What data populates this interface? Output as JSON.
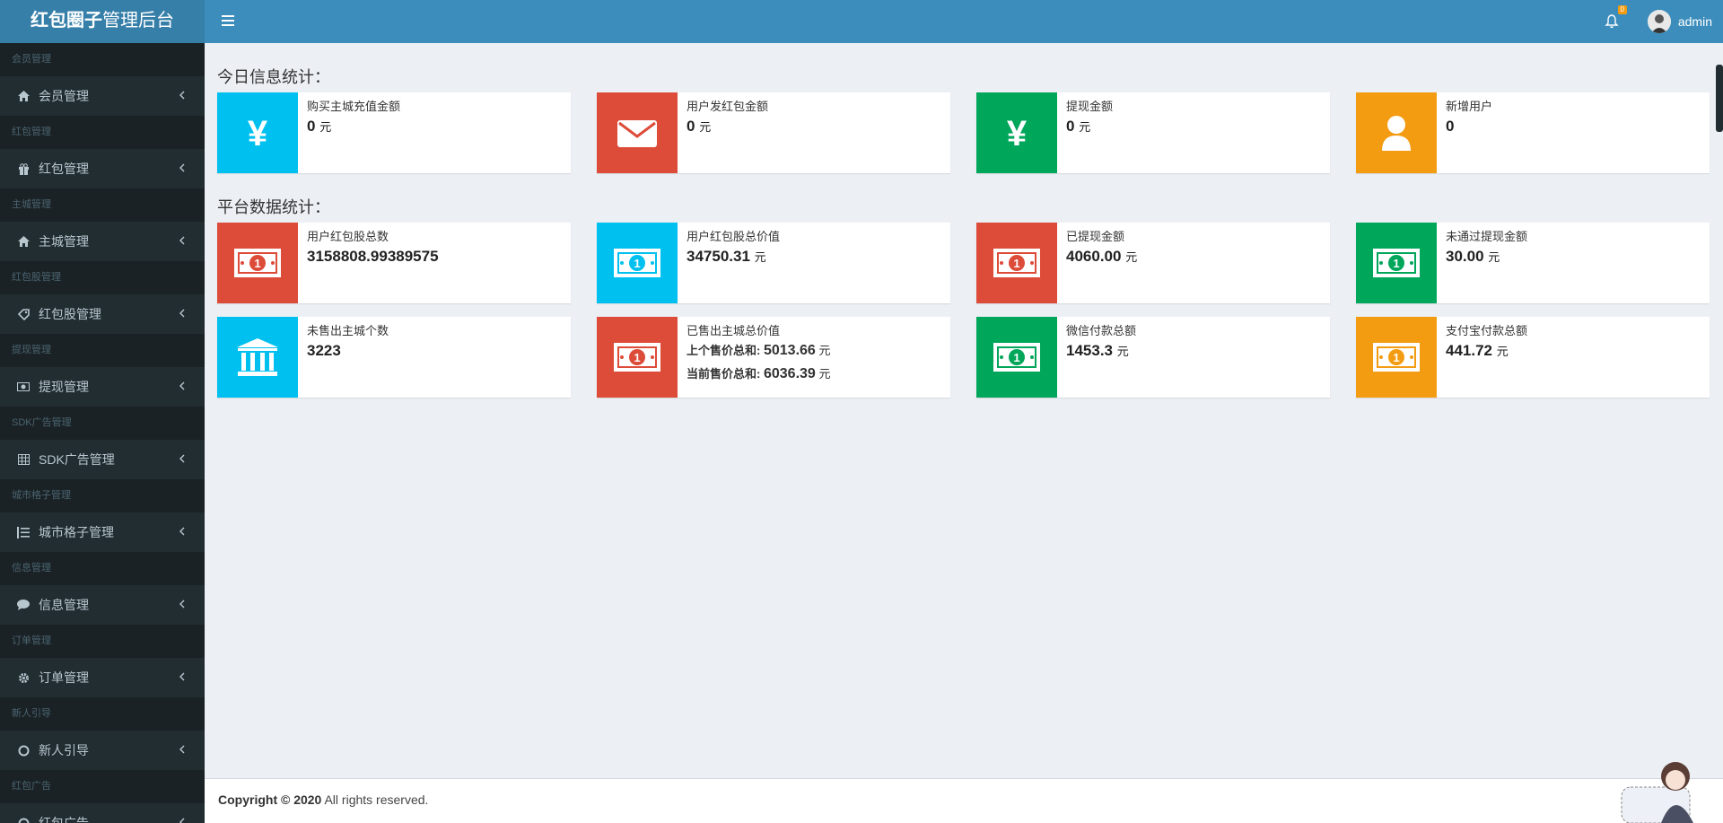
{
  "header": {
    "logo_bold": "红包圈子",
    "logo_rest": "管理后台",
    "notification_count": "0",
    "username": "admin"
  },
  "sidebar": [
    {
      "header": "会员管理",
      "label": "会员管理",
      "icon": "home-icon"
    },
    {
      "header": "红包管理",
      "label": "红包管理",
      "icon": "gift-icon"
    },
    {
      "header": "主城管理",
      "label": "主城管理",
      "icon": "home-icon"
    },
    {
      "header": "红包股管理",
      "label": "红包股管理",
      "icon": "tag-icon"
    },
    {
      "header": "提现管理",
      "label": "提现管理",
      "icon": "money-icon"
    },
    {
      "header": "SDK广告管理",
      "label": "SDK广告管理",
      "icon": "table-icon"
    },
    {
      "header": "城市格子管理",
      "label": "城市格子管理",
      "icon": "list-icon"
    },
    {
      "header": "信息管理",
      "label": "信息管理",
      "icon": "comment-icon"
    },
    {
      "header": "订单管理",
      "label": "订单管理",
      "icon": "gear-icon"
    },
    {
      "header": "新人引导",
      "label": "新人引导",
      "icon": "circle-icon"
    },
    {
      "header": "红包广告",
      "label": "红包广告",
      "icon": "circle-icon"
    }
  ],
  "today": {
    "title": "今日信息统计：",
    "boxes": [
      {
        "label": "购买主城充值金额",
        "value": "0",
        "unit": "元",
        "color": "#00c0ef",
        "icon": "yen-icon"
      },
      {
        "label": "用户发红包金额",
        "value": "0",
        "unit": "元",
        "color": "#dd4b39",
        "icon": "envelope-icon"
      },
      {
        "label": "提现金额",
        "value": "0",
        "unit": "元",
        "color": "#00a65a",
        "icon": "yen-icon"
      },
      {
        "label": "新增用户",
        "value": "0",
        "unit": "",
        "color": "#f39c12",
        "icon": "user-icon"
      }
    ]
  },
  "platform": {
    "title": "平台数据统计：",
    "boxes": [
      {
        "label": "用户红包股总数",
        "value": "3158808.99389575",
        "unit": "",
        "color": "#dd4b39",
        "icon": "money-icon"
      },
      {
        "label": "用户红包股总价值",
        "value": "34750.31",
        "unit": "元",
        "color": "#00c0ef",
        "icon": "money-icon"
      },
      {
        "label": "已提现金额",
        "value": "4060.00",
        "unit": "元",
        "color": "#dd4b39",
        "icon": "money-icon"
      },
      {
        "label": "未通过提现金额",
        "value": "30.00",
        "unit": "元",
        "color": "#00a65a",
        "icon": "money-icon"
      },
      {
        "label": "未售出主城个数",
        "value": "3223",
        "unit": "",
        "color": "#00c0ef",
        "icon": "bank-icon"
      },
      {
        "label": "已售出主城总价值",
        "sub1_label": "上个售价总和:",
        "sub1_value": "5013.66",
        "sub2_label": "当前售价总和:",
        "sub2_value": "6036.39",
        "unit": "元",
        "color": "#dd4b39",
        "icon": "money-icon"
      },
      {
        "label": "微信付款总额",
        "value": "1453.3",
        "unit": "元",
        "color": "#00a65a",
        "icon": "money-icon"
      },
      {
        "label": "支付宝付款总额",
        "value": "441.72",
        "unit": "元",
        "color": "#f39c12",
        "icon": "money-icon"
      }
    ]
  },
  "footer": {
    "copyright": "Copyright © 2020",
    "rest": "All rights reserved."
  }
}
